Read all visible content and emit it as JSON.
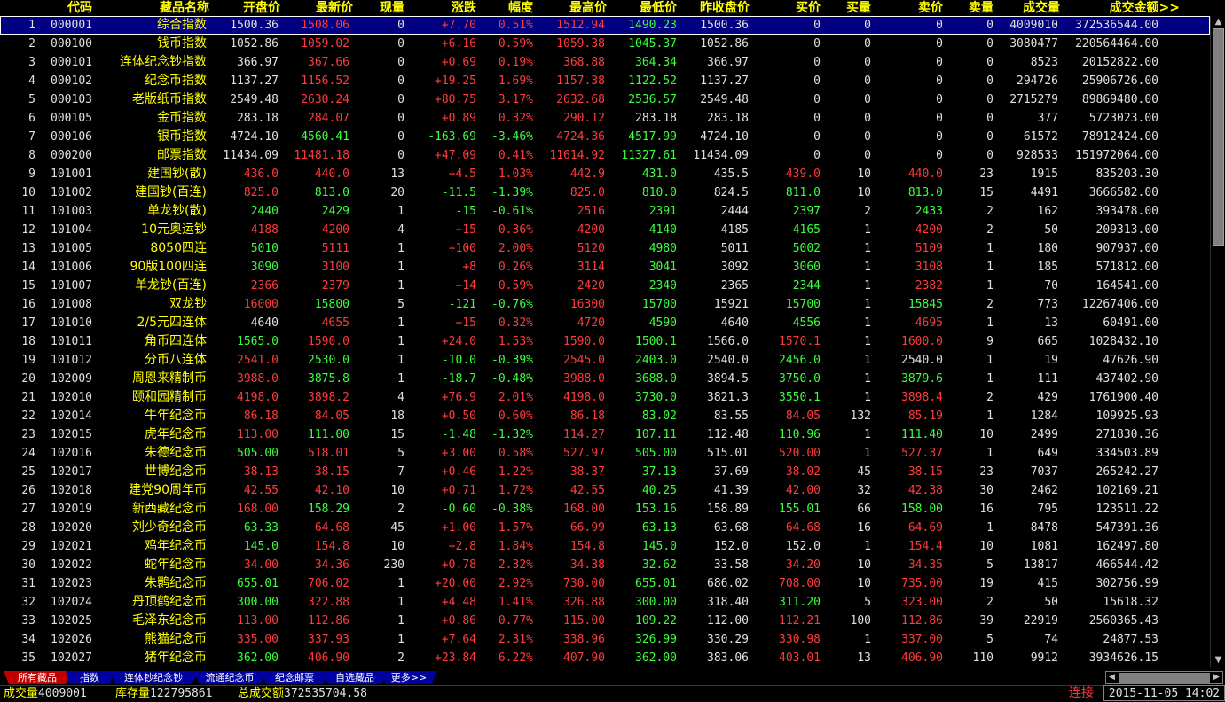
{
  "header": {
    "columns": [
      "",
      "代码",
      "藏品名称",
      "开盘价",
      "最新价",
      "现量",
      "涨跌",
      "幅度",
      "最高价",
      "最低价",
      "昨收盘价",
      "买价",
      "买量",
      "卖价",
      "卖量",
      "成交量",
      "成交金额>>"
    ]
  },
  "colors": {
    "up": "#ff3c3c",
    "down": "#3cff3c",
    "flat": "#e0e0e0",
    "label": "#ffff00",
    "selected_row": "#000080"
  },
  "rows": [
    [
      "1",
      "000001",
      "综合指数",
      "1500.36",
      "1508.06",
      "0",
      "+7.70",
      "0.51%",
      "1512.94",
      "1490.23",
      "1500.36",
      "0",
      "0",
      "0",
      "0",
      "4009010",
      "372536544.00"
    ],
    [
      "2",
      "000100",
      "钱币指数",
      "1052.86",
      "1059.02",
      "0",
      "+6.16",
      "0.59%",
      "1059.38",
      "1045.37",
      "1052.86",
      "0",
      "0",
      "0",
      "0",
      "3080477",
      "220564464.00"
    ],
    [
      "3",
      "000101",
      "连体纪念钞指数",
      "366.97",
      "367.66",
      "0",
      "+0.69",
      "0.19%",
      "368.88",
      "364.34",
      "366.97",
      "0",
      "0",
      "0",
      "0",
      "8523",
      "20152822.00"
    ],
    [
      "4",
      "000102",
      "纪念币指数",
      "1137.27",
      "1156.52",
      "0",
      "+19.25",
      "1.69%",
      "1157.38",
      "1122.52",
      "1137.27",
      "0",
      "0",
      "0",
      "0",
      "294726",
      "25906726.00"
    ],
    [
      "5",
      "000103",
      "老版纸币指数",
      "2549.48",
      "2630.24",
      "0",
      "+80.75",
      "3.17%",
      "2632.68",
      "2536.57",
      "2549.48",
      "0",
      "0",
      "0",
      "0",
      "2715279",
      "89869480.00"
    ],
    [
      "6",
      "000105",
      "金币指数",
      "283.18",
      "284.07",
      "0",
      "+0.89",
      "0.32%",
      "290.12",
      "283.18",
      "283.18",
      "0",
      "0",
      "0",
      "0",
      "377",
      "5723023.00"
    ],
    [
      "7",
      "000106",
      "银币指数",
      "4724.10",
      "4560.41",
      "0",
      "-163.69",
      "-3.46%",
      "4724.36",
      "4517.99",
      "4724.10",
      "0",
      "0",
      "0",
      "0",
      "61572",
      "78912424.00"
    ],
    [
      "8",
      "000200",
      "邮票指数",
      "11434.09",
      "11481.18",
      "0",
      "+47.09",
      "0.41%",
      "11614.92",
      "11327.61",
      "11434.09",
      "0",
      "0",
      "0",
      "0",
      "928533",
      "151972064.00"
    ],
    [
      "9",
      "101001",
      "建国钞(散)",
      "436.0",
      "440.0",
      "13",
      "+4.5",
      "1.03%",
      "442.9",
      "431.0",
      "435.5",
      "439.0",
      "10",
      "440.0",
      "23",
      "1915",
      "835203.30"
    ],
    [
      "10",
      "101002",
      "建国钞(百连)",
      "825.0",
      "813.0",
      "20",
      "-11.5",
      "-1.39%",
      "825.0",
      "810.0",
      "824.5",
      "811.0",
      "10",
      "813.0",
      "15",
      "4491",
      "3666582.00"
    ],
    [
      "11",
      "101003",
      "单龙钞(散)",
      "2440",
      "2429",
      "1",
      "-15",
      "-0.61%",
      "2516",
      "2391",
      "2444",
      "2397",
      "2",
      "2433",
      "2",
      "162",
      "393478.00"
    ],
    [
      "12",
      "101004",
      "10元奥运钞",
      "4188",
      "4200",
      "4",
      "+15",
      "0.36%",
      "4200",
      "4140",
      "4185",
      "4165",
      "1",
      "4200",
      "2",
      "50",
      "209313.00"
    ],
    [
      "13",
      "101005",
      "8050四连",
      "5010",
      "5111",
      "1",
      "+100",
      "2.00%",
      "5120",
      "4980",
      "5011",
      "5002",
      "1",
      "5109",
      "1",
      "180",
      "907937.00"
    ],
    [
      "14",
      "101006",
      "90版100四连",
      "3090",
      "3100",
      "1",
      "+8",
      "0.26%",
      "3114",
      "3041",
      "3092",
      "3060",
      "1",
      "3108",
      "1",
      "185",
      "571812.00"
    ],
    [
      "15",
      "101007",
      "单龙钞(百连)",
      "2366",
      "2379",
      "1",
      "+14",
      "0.59%",
      "2420",
      "2340",
      "2365",
      "2344",
      "1",
      "2382",
      "1",
      "70",
      "164541.00"
    ],
    [
      "16",
      "101008",
      "双龙钞",
      "16000",
      "15800",
      "5",
      "-121",
      "-0.76%",
      "16300",
      "15700",
      "15921",
      "15700",
      "1",
      "15845",
      "2",
      "773",
      "12267406.00"
    ],
    [
      "17",
      "101010",
      "2/5元四连体",
      "4640",
      "4655",
      "1",
      "+15",
      "0.32%",
      "4720",
      "4590",
      "4640",
      "4556",
      "1",
      "4695",
      "1",
      "13",
      "60491.00"
    ],
    [
      "18",
      "101011",
      "角币四连体",
      "1565.0",
      "1590.0",
      "1",
      "+24.0",
      "1.53%",
      "1590.0",
      "1500.1",
      "1566.0",
      "1570.1",
      "1",
      "1600.0",
      "9",
      "665",
      "1028432.10"
    ],
    [
      "19",
      "101012",
      "分币八连体",
      "2541.0",
      "2530.0",
      "1",
      "-10.0",
      "-0.39%",
      "2545.0",
      "2403.0",
      "2540.0",
      "2456.0",
      "1",
      "2540.0",
      "1",
      "19",
      "47626.90"
    ],
    [
      "20",
      "102009",
      "周恩来精制币",
      "3988.0",
      "3875.8",
      "1",
      "-18.7",
      "-0.48%",
      "3988.0",
      "3688.0",
      "3894.5",
      "3750.0",
      "1",
      "3879.6",
      "1",
      "111",
      "437402.90"
    ],
    [
      "21",
      "102010",
      "颐和园精制币",
      "4198.0",
      "3898.2",
      "4",
      "+76.9",
      "2.01%",
      "4198.0",
      "3730.0",
      "3821.3",
      "3550.1",
      "1",
      "3898.4",
      "2",
      "429",
      "1761900.40"
    ],
    [
      "22",
      "102014",
      "牛年纪念币",
      "86.18",
      "84.05",
      "18",
      "+0.50",
      "0.60%",
      "86.18",
      "83.02",
      "83.55",
      "84.05",
      "132",
      "85.19",
      "1",
      "1284",
      "109925.93"
    ],
    [
      "23",
      "102015",
      "虎年纪念币",
      "113.00",
      "111.00",
      "15",
      "-1.48",
      "-1.32%",
      "114.27",
      "107.11",
      "112.48",
      "110.96",
      "1",
      "111.40",
      "10",
      "2499",
      "271830.36"
    ],
    [
      "24",
      "102016",
      "朱德纪念币",
      "505.00",
      "518.01",
      "5",
      "+3.00",
      "0.58%",
      "527.97",
      "505.00",
      "515.01",
      "520.00",
      "1",
      "527.37",
      "1",
      "649",
      "334503.89"
    ],
    [
      "25",
      "102017",
      "世博纪念币",
      "38.13",
      "38.15",
      "7",
      "+0.46",
      "1.22%",
      "38.37",
      "37.13",
      "37.69",
      "38.02",
      "45",
      "38.15",
      "23",
      "7037",
      "265242.27"
    ],
    [
      "26",
      "102018",
      "建党90周年币",
      "42.55",
      "42.10",
      "10",
      "+0.71",
      "1.72%",
      "42.55",
      "40.25",
      "41.39",
      "42.00",
      "32",
      "42.38",
      "30",
      "2462",
      "102169.21"
    ],
    [
      "27",
      "102019",
      "新西藏纪念币",
      "168.00",
      "158.29",
      "2",
      "-0.60",
      "-0.38%",
      "168.00",
      "153.16",
      "158.89",
      "155.01",
      "66",
      "158.00",
      "16",
      "795",
      "123511.22"
    ],
    [
      "28",
      "102020",
      "刘少奇纪念币",
      "63.33",
      "64.68",
      "45",
      "+1.00",
      "1.57%",
      "66.99",
      "63.13",
      "63.68",
      "64.68",
      "16",
      "64.69",
      "1",
      "8478",
      "547391.36"
    ],
    [
      "29",
      "102021",
      "鸡年纪念币",
      "145.0",
      "154.8",
      "10",
      "+2.8",
      "1.84%",
      "154.8",
      "145.0",
      "152.0",
      "152.0",
      "1",
      "154.4",
      "10",
      "1081",
      "162497.80"
    ],
    [
      "30",
      "102022",
      "蛇年纪念币",
      "34.00",
      "34.36",
      "230",
      "+0.78",
      "2.32%",
      "34.38",
      "32.62",
      "33.58",
      "34.20",
      "10",
      "34.35",
      "5",
      "13817",
      "466544.42"
    ],
    [
      "31",
      "102023",
      "朱鹮纪念币",
      "655.01",
      "706.02",
      "1",
      "+20.00",
      "2.92%",
      "730.00",
      "655.01",
      "686.02",
      "708.00",
      "10",
      "735.00",
      "19",
      "415",
      "302756.99"
    ],
    [
      "32",
      "102024",
      "丹顶鹤纪念币",
      "300.00",
      "322.88",
      "1",
      "+4.48",
      "1.41%",
      "326.88",
      "300.00",
      "318.40",
      "311.20",
      "5",
      "323.00",
      "2",
      "50",
      "15618.32"
    ],
    [
      "33",
      "102025",
      "毛泽东纪念币",
      "113.00",
      "112.86",
      "1",
      "+0.86",
      "0.77%",
      "115.00",
      "109.22",
      "112.00",
      "112.21",
      "100",
      "112.86",
      "39",
      "22919",
      "2560365.43"
    ],
    [
      "34",
      "102026",
      "熊猫纪念币",
      "335.00",
      "337.93",
      "1",
      "+7.64",
      "2.31%",
      "338.96",
      "326.99",
      "330.29",
      "330.98",
      "1",
      "337.00",
      "5",
      "74",
      "24877.53"
    ],
    [
      "35",
      "102027",
      "猪年纪念币",
      "362.00",
      "406.90",
      "2",
      "+23.84",
      "6.22%",
      "407.90",
      "362.00",
      "383.06",
      "403.01",
      "13",
      "406.90",
      "110",
      "9912",
      "3934626.15"
    ]
  ],
  "tabs": [
    "所有藏品",
    "指数",
    "连体钞纪念钞",
    "流通纪念币",
    "纪念邮票",
    "自选藏品",
    "更多>>"
  ],
  "status": {
    "volume_label": "成交量",
    "volume_value": "4009001",
    "stock_label": "库存量",
    "stock_value": "122795861",
    "amount_label": "总成交额",
    "amount_value": "372535704.58",
    "connection": "连接",
    "datetime": "2015-11-05 14:02"
  },
  "icons": {
    "scroll_up": "triangle-up-icon",
    "scroll_down": "triangle-down-icon",
    "scroll_left": "triangle-left-icon",
    "scroll_right": "triangle-right-icon"
  }
}
